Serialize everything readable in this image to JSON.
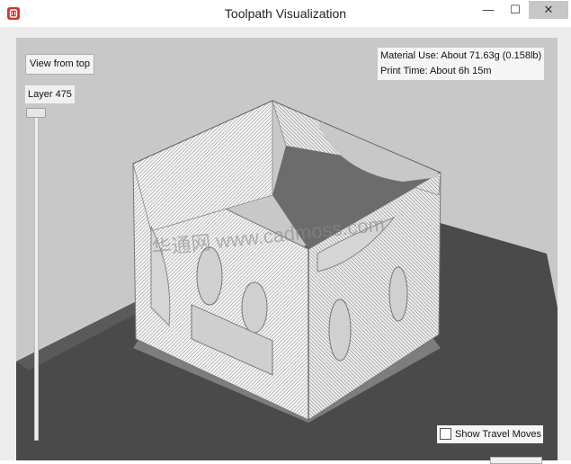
{
  "window": {
    "title": "Toolpath Visualization",
    "icon": "app-logo-icon",
    "controls": {
      "minimize": "—",
      "maximize": "☐",
      "close": "✕"
    }
  },
  "toolbar": {
    "view_from_top_label": "View from top"
  },
  "layer": {
    "label": "Layer 475",
    "slider_position": 1.0
  },
  "stats": {
    "material_use": "Material Use: About 71.63g (0.158lb)",
    "print_time": "Print Time: About 6h 15m"
  },
  "options": {
    "show_travel_moves_label": "Show Travel Moves",
    "show_travel_moves_checked": false
  },
  "watermark": "华通网 www.cadmoss.com",
  "colors": {
    "viewport_bg": "#c8c8c8",
    "build_plate": "#4a4a4a",
    "model": "#f2f2f2",
    "model_shadow": "#8a8a8a",
    "close_button": "#c7c7c7"
  }
}
